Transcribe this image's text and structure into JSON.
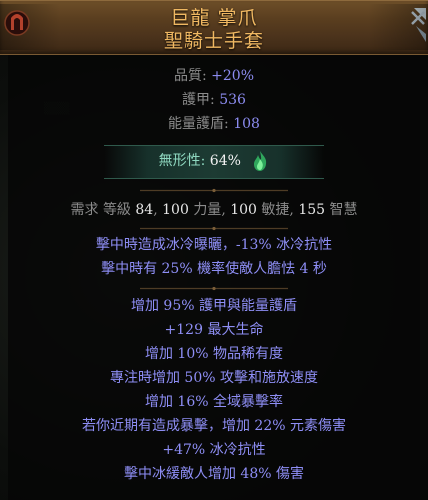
{
  "item": {
    "name": "巨龍 掌爪",
    "base_type": "聖騎士手套"
  },
  "properties": {
    "quality_label": "品質",
    "quality_value": "+20%",
    "armour_label": "護甲",
    "armour_value": "536",
    "energy_shield_label": "能量護盾",
    "energy_shield_value": "108"
  },
  "special": {
    "label": "無形性",
    "value": "64%",
    "icon": "green-flame-icon"
  },
  "requirements": {
    "prefix": "需求",
    "level_label": "等級",
    "level_value": "84",
    "str_value": "100",
    "str_label": "力量",
    "dex_value": "100",
    "dex_label": "敏捷",
    "int_value": "155",
    "int_label": "智慧"
  },
  "implicit_mods": [
    "擊中時造成冰冷曝曬，-13% 冰冷抗性",
    "擊中時有 25% 機率使敵人膽怯 4 秒"
  ],
  "explicit_mods": [
    "增加 95% 護甲與能量護盾",
    "+129 最大生命",
    "增加 10% 物品稀有度",
    "專注時增加 50% 攻擊和施放速度",
    "增加 16% 全域暴擊率",
    "若你近期有造成暴擊，增加 22% 元素傷害",
    "+47% 冰冷抗性",
    "擊中冰緩敵人增加 48% 傷害"
  ],
  "colors": {
    "name": "#f0b862",
    "magic_mod": "#8e8ef5",
    "label": "#8b8b8b",
    "header": "#5a3e1f"
  }
}
